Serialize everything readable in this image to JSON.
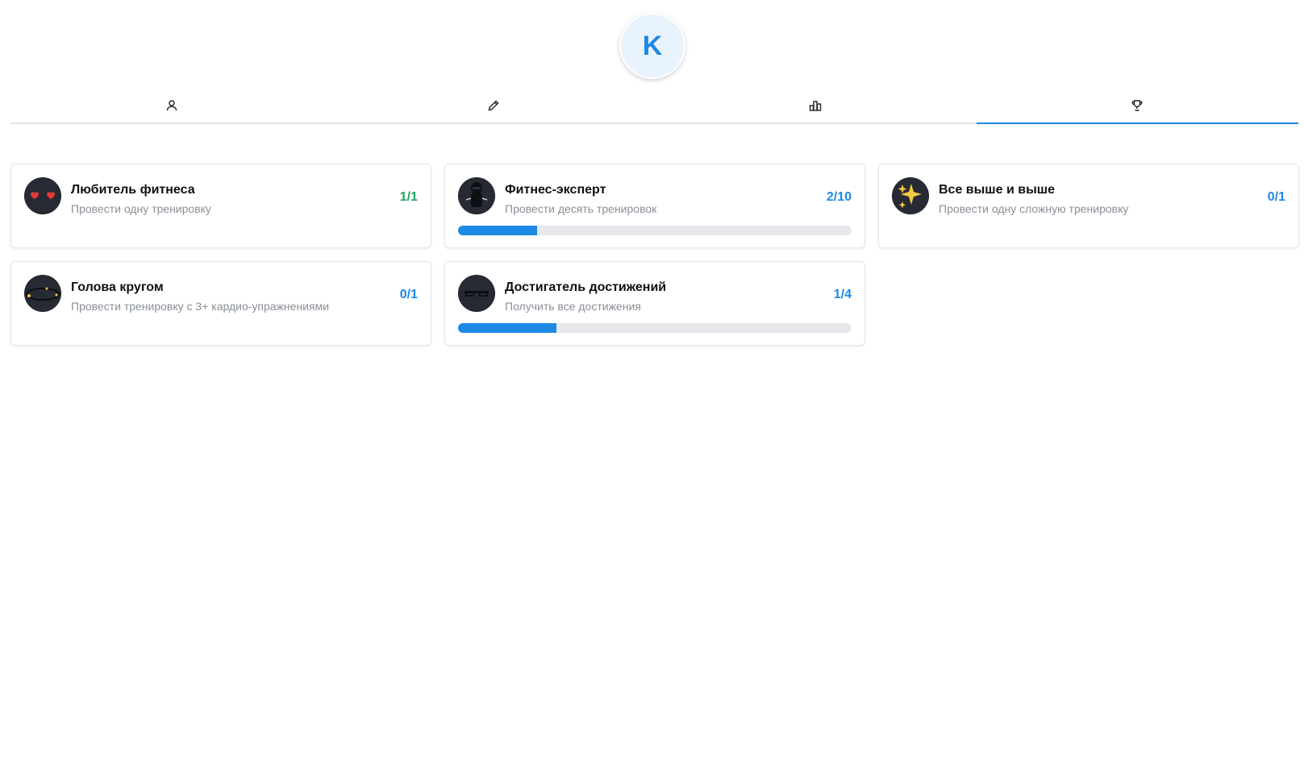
{
  "profile": {
    "avatar_initial": "K"
  },
  "tabs": [
    {
      "icon": "user-icon",
      "active": false
    },
    {
      "icon": "pencil-icon",
      "active": false
    },
    {
      "icon": "stats-icon",
      "active": false
    },
    {
      "icon": "trophy-icon",
      "active": true
    }
  ],
  "colors": {
    "accent": "#1e88e5",
    "complete": "#21a366",
    "badge_bg": "#262a33"
  },
  "achievements": [
    {
      "title": "Любитель фитнеса",
      "description": "Провести одну тренировку",
      "count": "1/1",
      "icon": "hearts-eyes-icon",
      "completed": true,
      "progress": 1.0,
      "show_bar": false
    },
    {
      "title": "Фитнес-эксперт",
      "description": "Провести десять тренировок",
      "count": "2/10",
      "icon": "ninja-icon",
      "completed": false,
      "progress": 0.2,
      "show_bar": true
    },
    {
      "title": "Все выше и выше",
      "description": "Провести одну сложную тренировку",
      "count": "0/1",
      "icon": "sparkles-icon",
      "completed": false,
      "progress": 0.0,
      "show_bar": false
    },
    {
      "title": "Голова кругом",
      "description": "Провести тренировку с 3+ кардио-упражнениями",
      "count": "0/1",
      "icon": "dizzy-face-icon",
      "completed": false,
      "progress": 0.0,
      "show_bar": false
    },
    {
      "title": "Достигатель достижений",
      "description": "Получить все достижения",
      "count": "1/4",
      "icon": "sunglasses-icon",
      "completed": false,
      "progress": 0.25,
      "show_bar": true
    }
  ]
}
